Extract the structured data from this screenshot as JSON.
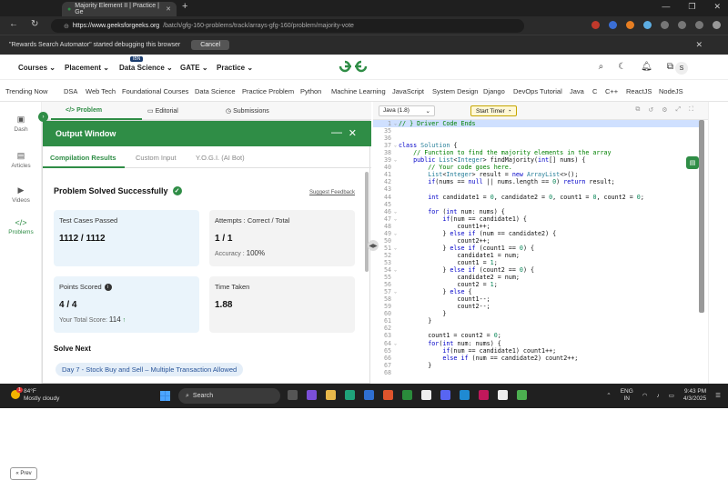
{
  "browser": {
    "tab_title": "Majority Element II | Practice | Ge",
    "new_tab": "+",
    "url_host": "https://www.geeksforgeeks.org",
    "url_path": "/batch/gfg-160-problems/track/arrays-gfg-160/problem/majority-vote",
    "debug_message": "\"Rewards Search Automator\" started debugging this browser",
    "cancel_label": "Cancel"
  },
  "header": {
    "menus": [
      "Courses",
      "Placement",
      "Data Science",
      "GATE",
      "Practice"
    ],
    "badge": "IBN",
    "logo": "GfG",
    "avatar": "S"
  },
  "topics": [
    "Trending Now",
    "DSA",
    "Web Tech",
    "Foundational Courses",
    "Data Science",
    "Practice Problem",
    "Python",
    "Machine Learning",
    "JavaScript",
    "System Design",
    "Django",
    "DevOps Tutorial",
    "Java",
    "C",
    "C++",
    "ReactJS",
    "NodeJS"
  ],
  "sidebar": {
    "items": [
      "Dash",
      "Articles",
      "Videos",
      "Problems"
    ],
    "prev": "Prev"
  },
  "problem_tabs": [
    "Problem",
    "Editorial",
    "Submissions"
  ],
  "output": {
    "title": "Output Window",
    "tabs": [
      "Compilation Results",
      "Custom Input",
      "Y.O.G.I. (AI Bot)"
    ],
    "status": "Problem Solved Successfully",
    "feedback": "Suggest Feedback",
    "test_cases_label": "Test Cases Passed",
    "test_cases_value": "1112 / 1112",
    "attempts_label": "Attempts : Correct / Total",
    "attempts_value": "1 / 1",
    "accuracy_label": "Accuracy :",
    "accuracy_value": "100%",
    "points_label": "Points Scored",
    "points_value": "4 / 4",
    "total_score_label": "Your Total Score:",
    "total_score_value": "114",
    "time_label": "Time Taken",
    "time_value": "1.88",
    "solve_next_label": "Solve Next",
    "solve_next_item": "Day 7 - Stock Buy and Sell – Multiple Transaction Allowed"
  },
  "editor": {
    "language": "Java (1.8)",
    "timer": "Start Timer",
    "lines": [
      {
        "n": "1",
        "fold": true,
        "text": "// } Driver Code Ends",
        "hl": true
      },
      {
        "n": "35",
        "text": ""
      },
      {
        "n": "36",
        "text": ""
      },
      {
        "n": "37",
        "fold": true,
        "text": "class Solution {"
      },
      {
        "n": "38",
        "text": "    // Function to find the majority elements in the array"
      },
      {
        "n": "39",
        "fold": true,
        "text": "    public List<Integer> findMajority(int[] nums) {"
      },
      {
        "n": "40",
        "text": "        // Your code goes here."
      },
      {
        "n": "41",
        "text": "        List<Integer> result = new ArrayList<>();"
      },
      {
        "n": "42",
        "text": "        if(nums == null || nums.length == 0) return result;"
      },
      {
        "n": "43",
        "text": ""
      },
      {
        "n": "44",
        "text": "        int candidate1 = 0, candidate2 = 0, count1 = 0, count2 = 0;"
      },
      {
        "n": "45",
        "text": ""
      },
      {
        "n": "46",
        "fold": true,
        "text": "        for (int num: nums) {"
      },
      {
        "n": "47",
        "fold": true,
        "text": "            if(num == candidate1) {"
      },
      {
        "n": "48",
        "text": "                count1++;"
      },
      {
        "n": "49",
        "fold": true,
        "text": "            } else if (num == candidate2) {"
      },
      {
        "n": "50",
        "text": "                count2++;"
      },
      {
        "n": "51",
        "fold": true,
        "text": "            } else if (count1 == 0) {"
      },
      {
        "n": "52",
        "text": "                candidate1 = num;"
      },
      {
        "n": "53",
        "text": "                count1 = 1;"
      },
      {
        "n": "54",
        "fold": true,
        "text": "            } else if (count2 == 0) {"
      },
      {
        "n": "55",
        "text": "                candidate2 = num;"
      },
      {
        "n": "56",
        "text": "                count2 = 1;"
      },
      {
        "n": "57",
        "fold": true,
        "text": "            } else {"
      },
      {
        "n": "58",
        "text": "                count1--;"
      },
      {
        "n": "59",
        "text": "                count2--;"
      },
      {
        "n": "60",
        "text": "            }"
      },
      {
        "n": "61",
        "text": "        }"
      },
      {
        "n": "62",
        "text": ""
      },
      {
        "n": "63",
        "text": "        count1 = count2 = 0;"
      },
      {
        "n": "64",
        "fold": true,
        "text": "        for(int num: nums) {"
      },
      {
        "n": "65",
        "text": "            if(num == candidate1) count1++;"
      },
      {
        "n": "66",
        "text": "            else if (num == candidate2) count2++;"
      },
      {
        "n": "67",
        "text": "        }"
      },
      {
        "n": "68",
        "text": ""
      }
    ]
  },
  "taskbar": {
    "weather_temp": "84°F",
    "weather_desc": "Mostly cloudy",
    "weather_badge": "1",
    "search": "Search",
    "lang1": "ENG",
    "lang2": "IN",
    "time": "9:43 PM",
    "date": "4/3/2025"
  },
  "colors": {
    "accent": "#2f8d46",
    "blue_card": "#eaf4fb",
    "gray_card": "#f3f3f3"
  }
}
